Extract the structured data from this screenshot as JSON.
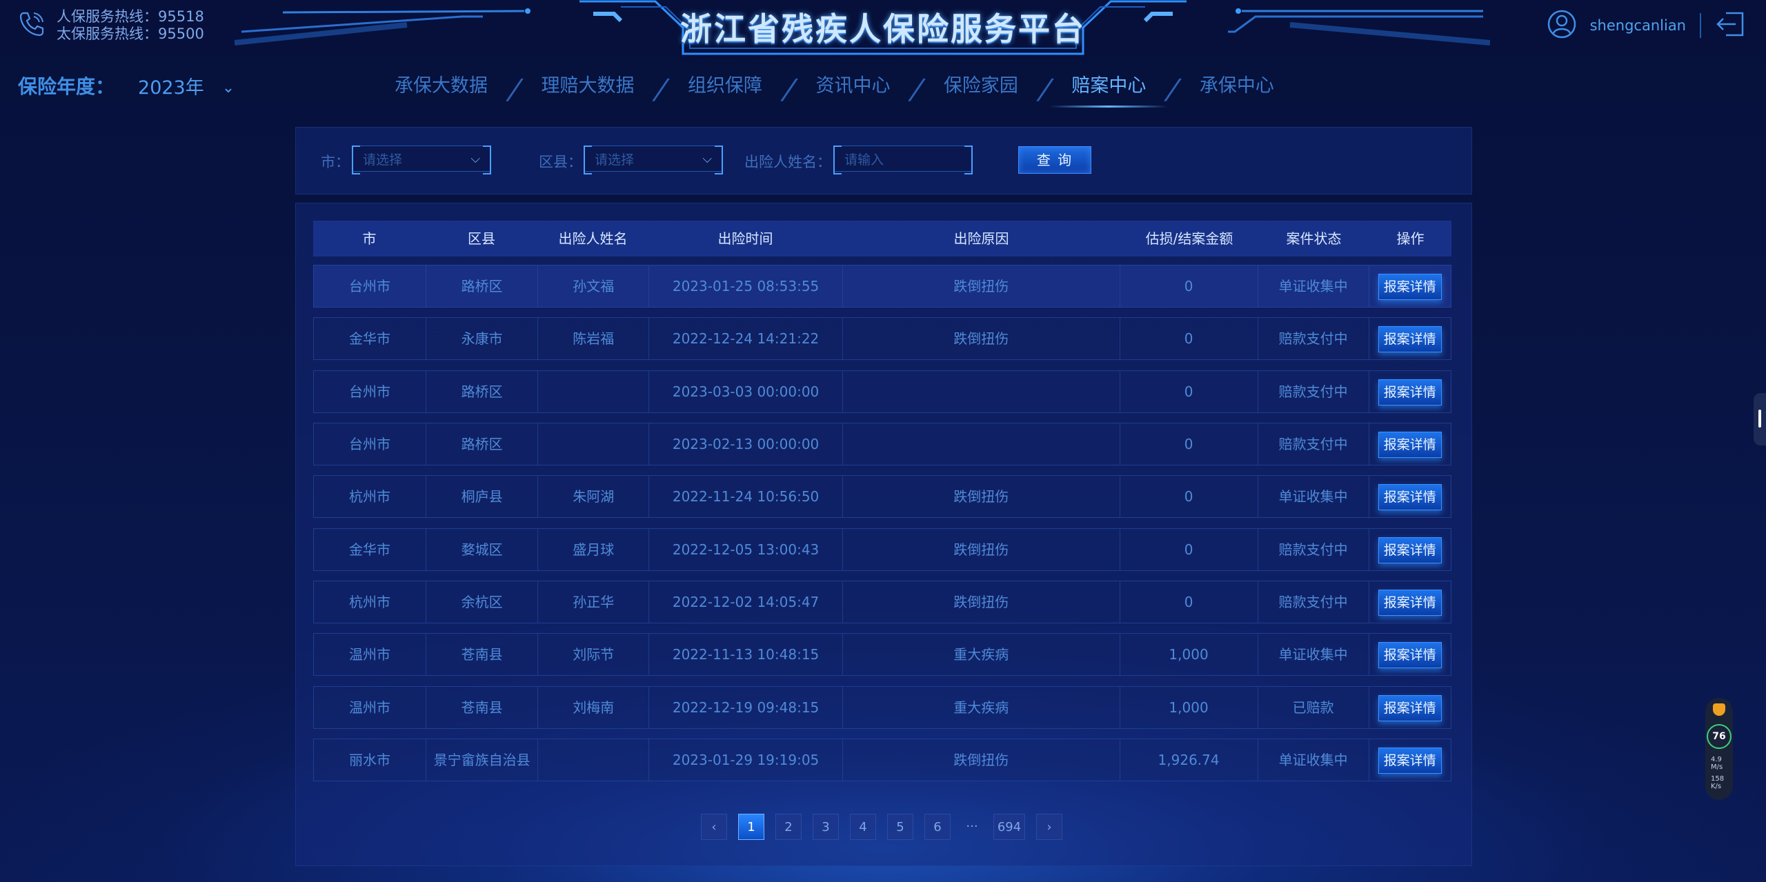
{
  "header": {
    "title": "浙江省残疾人保险服务平台",
    "hotline_1": "人保服务热线：95518",
    "hotline_2": "太保服务热线：95500",
    "username": "shengcanlian"
  },
  "year_selector": {
    "label": "保险年度：",
    "value": "2023年"
  },
  "nav": {
    "items": [
      {
        "label": "承保大数据"
      },
      {
        "label": "理赔大数据"
      },
      {
        "label": "组织保障"
      },
      {
        "label": "资讯中心"
      },
      {
        "label": "保险家园"
      },
      {
        "label": "赔案中心",
        "active": true
      },
      {
        "label": "承保中心"
      }
    ]
  },
  "filter": {
    "city_label": "市：",
    "city_placeholder": "请选择",
    "district_label": "区县：",
    "district_placeholder": "请选择",
    "name_label": "出险人姓名：",
    "name_placeholder": "请输入",
    "query_label": "查 询"
  },
  "table": {
    "headers": [
      "市",
      "区县",
      "出险人姓名",
      "出险时间",
      "出险原因",
      "估损/结案金额",
      "案件状态",
      "操作"
    ],
    "action_label": "报案详情",
    "rows": [
      [
        "台州市",
        "路桥区",
        "孙文福",
        "2023-01-25 08:53:55",
        "跌倒扭伤",
        "0",
        "单证收集中"
      ],
      [
        "金华市",
        "永康市",
        "陈岩福",
        "2022-12-24 14:21:22",
        "跌倒扭伤",
        "0",
        "赔款支付中"
      ],
      [
        "台州市",
        "路桥区",
        "",
        "2023-03-03 00:00:00",
        "",
        "0",
        "赔款支付中"
      ],
      [
        "台州市",
        "路桥区",
        "",
        "2023-02-13 00:00:00",
        "",
        "0",
        "赔款支付中"
      ],
      [
        "杭州市",
        "桐庐县",
        "朱阿湖",
        "2022-11-24 10:56:50",
        "跌倒扭伤",
        "0",
        "单证收集中"
      ],
      [
        "金华市",
        "婺城区",
        "盛月球",
        "2022-12-05 13:00:43",
        "跌倒扭伤",
        "0",
        "赔款支付中"
      ],
      [
        "杭州市",
        "余杭区",
        "孙正华",
        "2022-12-02 14:05:47",
        "跌倒扭伤",
        "0",
        "赔款支付中"
      ],
      [
        "温州市",
        "苍南县",
        "刘际节",
        "2022-11-13 10:48:15",
        "重大疾病",
        "1,000",
        "单证收集中"
      ],
      [
        "温州市",
        "苍南县",
        "刘梅南",
        "2022-12-19 09:48:15",
        "重大疾病",
        "1,000",
        "已赔款"
      ],
      [
        "丽水市",
        "景宁畲族自治县",
        "",
        "2023-01-29 19:19:05",
        "跌倒扭伤",
        "1,926.74",
        "单证收集中"
      ]
    ]
  },
  "pagination": {
    "prev": "‹",
    "pages": [
      "1",
      "2",
      "3",
      "4",
      "5",
      "6"
    ],
    "ellipsis": "···",
    "last": "694",
    "next": "›",
    "current": "1"
  },
  "speed_widget": {
    "score": "76",
    "upload": "4.9 M/s",
    "download": "158 K/s"
  },
  "icons": [
    "phone-icon",
    "user-avatar-icon",
    "logout-icon",
    "chevron-down-icon",
    "chevron-left-icon",
    "chevron-right-icon",
    "shield-icon"
  ]
}
